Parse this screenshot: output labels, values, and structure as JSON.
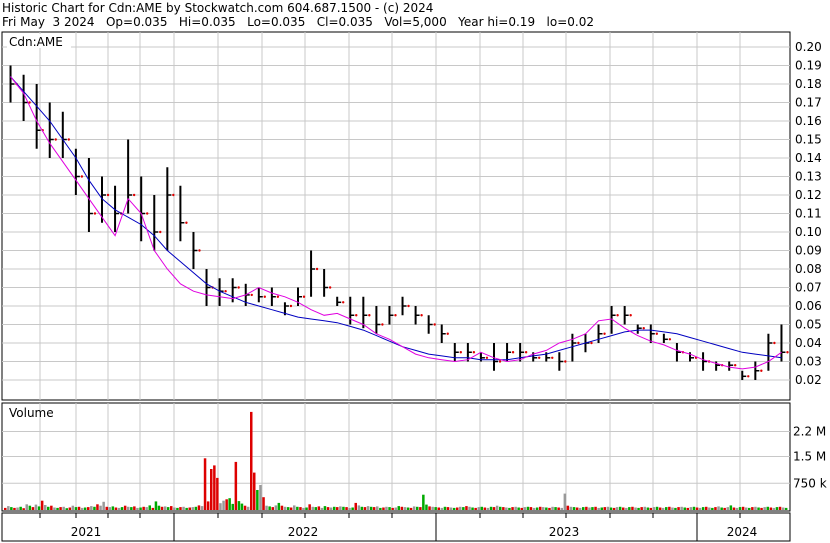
{
  "header": {
    "line1": "Historic Chart for Cdn:AME by Stockwatch.com 604.687.1500 - (c) 2024",
    "line2": "Fri May  3 2024   Op=0.035   Hi=0.035   Lo=0.035   Cl=0.035   Vol=5,000   Year hi=0.19   lo=0.02"
  },
  "chart_data": [
    {
      "type": "ohlc",
      "title": "Cdn:AME",
      "ylim": [
        0.01,
        0.205
      ],
      "y_ticks": [
        "0.20",
        "0.19",
        "0.18",
        "0.17",
        "0.16",
        "0.15",
        "0.14",
        "0.13",
        "0.12",
        "0.11",
        "0.10",
        "0.09",
        "0.08",
        "0.07",
        "0.06",
        "0.05",
        "0.04",
        "0.03",
        "0.02"
      ],
      "y_tick_values": [
        0.2,
        0.19,
        0.18,
        0.17,
        0.16,
        0.15,
        0.14,
        0.13,
        0.12,
        0.11,
        0.1,
        0.09,
        0.08,
        0.07,
        0.06,
        0.05,
        0.04,
        0.03,
        0.02
      ],
      "x_labels": [
        "2021",
        "2022",
        "2023",
        "2024"
      ],
      "grid": true,
      "colors": {
        "price": "#000000",
        "ma_short": "#e000e0",
        "ma_long": "#0000c0",
        "close_marker": "#e00000",
        "grid": "#c8c8c8"
      },
      "series": [
        {
          "values": [
            0.184,
            0.176,
            0.168,
            0.16,
            0.15,
            0.14,
            0.128,
            0.118,
            0.112,
            0.108,
            0.104,
            0.098,
            0.09,
            0.084,
            0.078,
            0.072,
            0.068,
            0.065,
            0.062,
            0.06,
            0.058,
            0.056,
            0.054,
            0.053,
            0.052,
            0.051,
            0.049,
            0.047,
            0.044,
            0.041,
            0.038,
            0.036,
            0.034,
            0.033,
            0.032,
            0.032,
            0.031,
            0.031,
            0.031,
            0.032,
            0.033,
            0.034,
            0.036,
            0.038,
            0.04,
            0.042,
            0.044,
            0.046,
            0.047,
            0.047,
            0.046,
            0.045,
            0.043,
            0.041,
            0.039,
            0.037,
            0.035,
            0.034,
            0.033,
            0.032
          ]
        },
        {
          "values": [
            0.184,
            0.175,
            0.16,
            0.148,
            0.138,
            0.128,
            0.118,
            0.108,
            0.098,
            0.118,
            0.11,
            0.09,
            0.08,
            0.072,
            0.068,
            0.066,
            0.065,
            0.064,
            0.066,
            0.07,
            0.067,
            0.065,
            0.062,
            0.058,
            0.055,
            0.056,
            0.053,
            0.05,
            0.045,
            0.042,
            0.038,
            0.034,
            0.032,
            0.031,
            0.03,
            0.031,
            0.035,
            0.032,
            0.03,
            0.031,
            0.034,
            0.036,
            0.04,
            0.042,
            0.045,
            0.052,
            0.053,
            0.048,
            0.044,
            0.041,
            0.039,
            0.036,
            0.034,
            0.031,
            0.029,
            0.027,
            0.026,
            0.027,
            0.03,
            0.035
          ]
        }
      ],
      "ohlc": [
        [
          0.19,
          0.17,
          0.18
        ],
        [
          0.185,
          0.16,
          0.17
        ],
        [
          0.18,
          0.145,
          0.155
        ],
        [
          0.17,
          0.14,
          0.15
        ],
        [
          0.165,
          0.14,
          0.15
        ],
        [
          0.145,
          0.12,
          0.13
        ],
        [
          0.14,
          0.1,
          0.11
        ],
        [
          0.13,
          0.105,
          0.12
        ],
        [
          0.125,
          0.1,
          0.11
        ],
        [
          0.15,
          0.11,
          0.12
        ],
        [
          0.13,
          0.095,
          0.11
        ],
        [
          0.12,
          0.09,
          0.1
        ],
        [
          0.135,
          0.09,
          0.12
        ],
        [
          0.125,
          0.095,
          0.105
        ],
        [
          0.1,
          0.08,
          0.09
        ],
        [
          0.08,
          0.06,
          0.07
        ],
        [
          0.075,
          0.06,
          0.068
        ],
        [
          0.075,
          0.062,
          0.07
        ],
        [
          0.072,
          0.06,
          0.066
        ],
        [
          0.07,
          0.062,
          0.065
        ],
        [
          0.07,
          0.06,
          0.065
        ],
        [
          0.062,
          0.055,
          0.06
        ],
        [
          0.07,
          0.06,
          0.065
        ],
        [
          0.09,
          0.065,
          0.08
        ],
        [
          0.08,
          0.065,
          0.07
        ],
        [
          0.065,
          0.06,
          0.062
        ],
        [
          0.065,
          0.05,
          0.055
        ],
        [
          0.065,
          0.048,
          0.055
        ],
        [
          0.06,
          0.045,
          0.05
        ],
        [
          0.06,
          0.05,
          0.055
        ],
        [
          0.065,
          0.055,
          0.06
        ],
        [
          0.06,
          0.05,
          0.055
        ],
        [
          0.055,
          0.045,
          0.05
        ],
        [
          0.05,
          0.04,
          0.045
        ],
        [
          0.04,
          0.03,
          0.035
        ],
        [
          0.04,
          0.03,
          0.035
        ],
        [
          0.035,
          0.03,
          0.032
        ],
        [
          0.04,
          0.025,
          0.03
        ],
        [
          0.04,
          0.03,
          0.035
        ],
        [
          0.04,
          0.03,
          0.035
        ],
        [
          0.035,
          0.03,
          0.032
        ],
        [
          0.035,
          0.03,
          0.032
        ],
        [
          0.035,
          0.025,
          0.03
        ],
        [
          0.045,
          0.03,
          0.04
        ],
        [
          0.045,
          0.035,
          0.04
        ],
        [
          0.05,
          0.04,
          0.045
        ],
        [
          0.06,
          0.045,
          0.055
        ],
        [
          0.06,
          0.05,
          0.055
        ],
        [
          0.05,
          0.045,
          0.048
        ],
        [
          0.05,
          0.04,
          0.045
        ],
        [
          0.045,
          0.04,
          0.042
        ],
        [
          0.04,
          0.03,
          0.035
        ],
        [
          0.035,
          0.03,
          0.032
        ],
        [
          0.035,
          0.025,
          0.03
        ],
        [
          0.03,
          0.025,
          0.028
        ],
        [
          0.03,
          0.025,
          0.028
        ],
        [
          0.025,
          0.02,
          0.022
        ],
        [
          0.03,
          0.02,
          0.025
        ],
        [
          0.045,
          0.025,
          0.04
        ],
        [
          0.05,
          0.03,
          0.035
        ]
      ]
    },
    {
      "type": "bar",
      "title": "Volume",
      "y_ticks": [
        "2.2 M",
        "1.5 M",
        "750 k"
      ],
      "y_tick_values": [
        2200000,
        1500000,
        750000
      ],
      "ylim": [
        0,
        3000000
      ],
      "colors": {
        "up": "#00aa00",
        "down": "#dd0000",
        "flat": "#999999"
      },
      "values": [
        60000,
        110000,
        80000,
        60000,
        70000,
        90000,
        50000,
        160000,
        120000,
        80000,
        150000,
        100000,
        260000,
        140000,
        90000,
        120000,
        70000,
        60000,
        80000,
        90000,
        50000,
        70000,
        120000,
        80000,
        90000,
        60000,
        70000,
        80000,
        110000,
        90000,
        160000,
        120000,
        230000,
        90000,
        80000,
        100000,
        70000,
        60000,
        80000,
        120000,
        90000,
        80000,
        100000,
        60000,
        70000,
        90000,
        80000,
        130000,
        60000,
        240000,
        120000,
        90000,
        100000,
        80000,
        110000,
        70000,
        60000,
        80000,
        90000,
        60000,
        70000,
        80000,
        90000,
        130000,
        110000,
        1450000,
        240000,
        1150000,
        1250000,
        900000,
        190000,
        260000,
        300000,
        330000,
        170000,
        1350000,
        250000,
        180000,
        120000,
        90000,
        2750000,
        1050000,
        560000,
        700000,
        360000,
        120000,
        100000,
        80000,
        130000,
        200000,
        120000,
        90000,
        80000,
        70000,
        130000,
        90000,
        80000,
        60000,
        70000,
        160000,
        90000,
        80000,
        100000,
        60000,
        110000,
        80000,
        70000,
        90000,
        80000,
        100000,
        90000,
        80000,
        60000,
        70000,
        200000,
        130000,
        90000,
        80000,
        110000,
        90000,
        80000,
        100000,
        60000,
        70000,
        90000,
        80000,
        60000,
        70000,
        110000,
        90000,
        80000,
        70000,
        60000,
        100000,
        90000,
        80000,
        430000,
        150000,
        100000,
        90000,
        80000,
        70000,
        60000,
        90000,
        80000,
        70000,
        60000,
        70000,
        90000,
        80000,
        110000,
        90000,
        70000,
        60000,
        80000,
        90000,
        70000,
        60000,
        90000,
        80000,
        120000,
        90000,
        80000,
        70000,
        60000,
        80000,
        90000,
        70000,
        60000,
        80000,
        90000,
        80000,
        60000,
        70000,
        90000,
        80000,
        70000,
        60000,
        90000,
        80000,
        70000,
        60000,
        460000,
        120000,
        90000,
        80000,
        70000,
        60000,
        80000,
        90000,
        70000,
        80000,
        90000,
        60000,
        70000,
        80000,
        90000,
        70000,
        60000,
        80000,
        90000,
        70000,
        60000,
        80000,
        90000,
        70000,
        60000,
        80000,
        90000,
        70000,
        60000,
        80000,
        90000,
        70000,
        60000,
        80000,
        90000,
        70000,
        60000,
        80000,
        90000,
        70000,
        60000,
        80000,
        90000,
        70000,
        60000,
        80000,
        90000,
        70000,
        60000,
        80000,
        100000,
        70000,
        60000,
        80000,
        130000,
        70000,
        60000,
        80000,
        90000,
        70000,
        60000,
        80000,
        90000,
        70000,
        60000,
        80000,
        90000,
        70000,
        60000,
        80000,
        90000,
        70000,
        60000
      ]
    }
  ]
}
